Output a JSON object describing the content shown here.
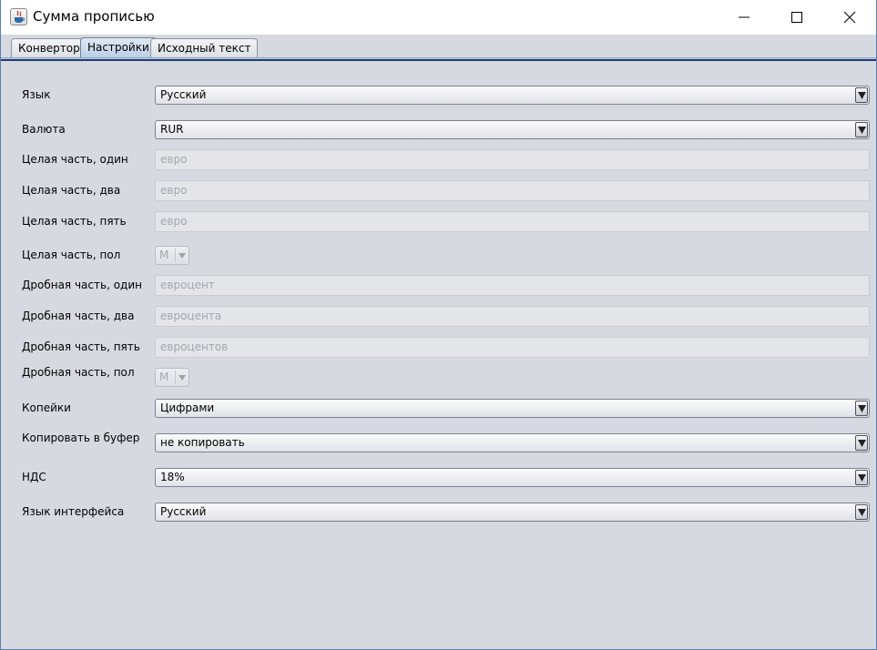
{
  "window": {
    "title": "Сумма прописью",
    "app_icon": "java-cup-icon",
    "controls": [
      "minimize-icon",
      "maximize-icon",
      "close-icon"
    ]
  },
  "tabs": [
    {
      "label": "Конвертор",
      "active": false
    },
    {
      "label": "Настройки",
      "active": true
    },
    {
      "label": "Исходный текст",
      "active": false
    }
  ],
  "settings": {
    "language": {
      "label": "Язык",
      "value": "Русский"
    },
    "currency": {
      "label": "Валюта",
      "value": "RUR"
    },
    "int_one": {
      "label": "Целая часть, один",
      "value": "евро"
    },
    "int_two": {
      "label": "Целая часть, два",
      "value": "евро"
    },
    "int_five": {
      "label": "Целая часть, пять",
      "value": "евро"
    },
    "int_gender": {
      "label": "Целая часть, пол",
      "value": "М"
    },
    "frac_one": {
      "label": "Дробная часть, один",
      "value": "евроцент"
    },
    "frac_two": {
      "label": "Дробная часть, два",
      "value": "евроцента"
    },
    "frac_five": {
      "label": "Дробная часть, пять",
      "value": "евроцентов"
    },
    "frac_gender": {
      "label": "Дробная часть, пол",
      "value": "М"
    },
    "kopecks": {
      "label": "Копейки",
      "value": "Цифрами"
    },
    "copy_to_buffer": {
      "label": "Копировать в буфер",
      "value": "не копировать"
    },
    "vat": {
      "label": "НДС",
      "value": "18%"
    },
    "ui_language": {
      "label": "Язык интерфейса",
      "value": "Русский"
    }
  },
  "colors": {
    "background": "#d6d9df",
    "active_tab": "#b9cde4",
    "disabled_text": "#a3a7ae"
  }
}
